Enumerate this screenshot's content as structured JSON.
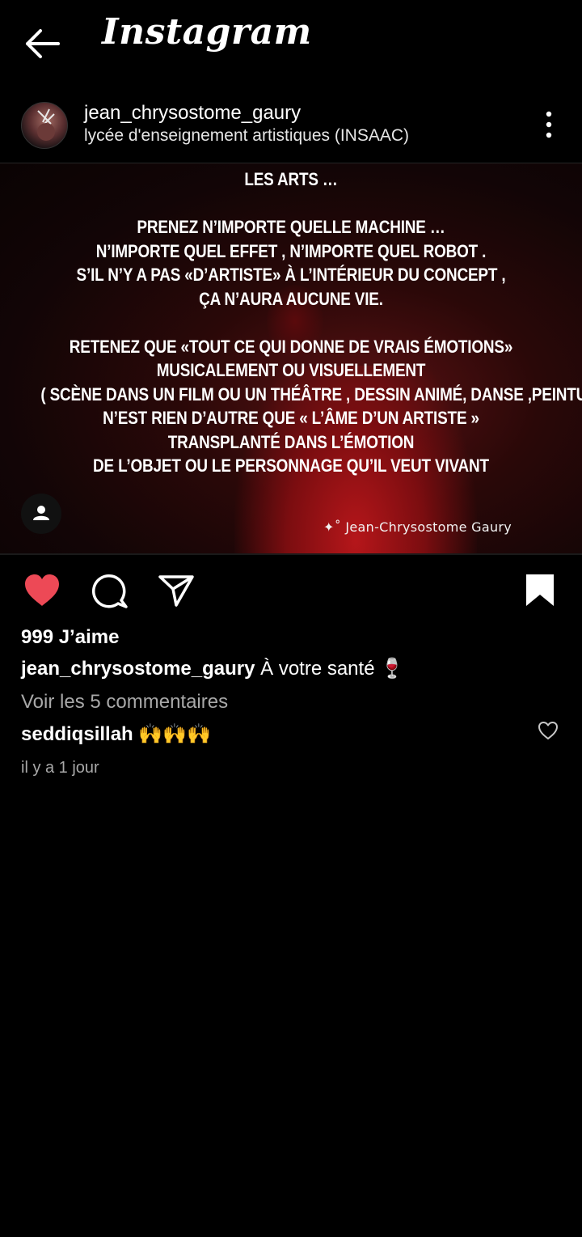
{
  "app": {
    "name": "Instagram",
    "icons": {
      "back": "arrow-left-icon",
      "more": "more-vertical-icon"
    }
  },
  "post": {
    "username": "jean_chrysostome_gaury",
    "location": "lycée d'enseignement artistiques (INSAAC)",
    "image_text": {
      "title": "LES ARTS …",
      "paragraph1": [
        "PRENEZ N’IMPORTE QUELLE MACHINE …",
        "N’IMPORTE QUEL EFFET , N’IMPORTE QUEL ROBOT .",
        "S’IL N’Y A PAS «D’ARTISTE» À L’INTÉRIEUR DU CONCEPT ,",
        "ÇA N’AURA AUCUNE VIE."
      ],
      "paragraph2": [
        "RETENEZ QUE «TOUT CE QUI DONNE DE VRAIS ÉMOTIONS»",
        "MUSICALEMENT OU  VISUELLEMENT",
        "( SCÈNE DANS UN FILM OU UN THÉÂTRE , DESSIN ANIMÉ, DANSE ,PEINTURE ETC )",
        "N’EST RIEN D’AUTRE QUE « L’ÂME D’UN ARTISTE »",
        "TRANSPLANTÉ DANS L’ÉMOTION",
        "DE L’OBJET OU LE PERSONNAGE QU’IL VEUT VIVANT"
      ],
      "watermark": "✦˚ Jean-Chrysostome Gaury"
    },
    "actions": {
      "liked": true,
      "like_color": "#ed4956",
      "icons": [
        "heart-filled-icon",
        "comment-icon",
        "share-icon",
        "bookmark-filled-icon"
      ]
    },
    "likes_text": "999 J’aime",
    "caption": {
      "username": "jean_chrysostome_gaury",
      "text": " À votre santé 🍷"
    },
    "view_comments": "Voir les 5 commentaires",
    "comment": {
      "username": "seddiqsillah",
      "text": " 🙌🙌🙌"
    },
    "timestamp": "il y a 1 jour"
  }
}
